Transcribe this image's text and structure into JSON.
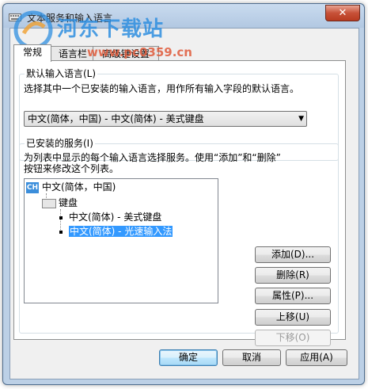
{
  "window": {
    "title": "文本服务和输入语言",
    "close_label": "✕"
  },
  "tabs": [
    {
      "label": "常规"
    },
    {
      "label": "语言栏"
    },
    {
      "label": "高级键设置"
    }
  ],
  "default_language": {
    "group_label": "默认输入语言(L)",
    "description": "选择其中一个已安装的输入语言，用作所有输入字段的默认语言。",
    "selected_value": "中文(简体，中国) - 中文(简体) - 美式键盘"
  },
  "installed_services": {
    "group_label": "已安装的服务(I)",
    "description_line1": "为列表中显示的每个输入语言选择服务。使用“添加”和“删除”",
    "description_line2": "按钮来修改这个列表。",
    "tree": {
      "language_code": "CH",
      "language": "中文(简体，中国)",
      "category": "键盘",
      "services": [
        "中文(简体) - 美式键盘",
        "中文(简体) - 光速输入法"
      ]
    },
    "buttons": {
      "add": "添加(D)...",
      "remove": "删除(R)",
      "properties": "属性(P)...",
      "move_up": "上移(U)",
      "move_down": "下移(O)"
    }
  },
  "footer": {
    "ok": "确定",
    "cancel": "取消",
    "apply": "应用(A)"
  },
  "watermark": {
    "text": "河东下载站",
    "url": "www.pc0359.cn"
  }
}
